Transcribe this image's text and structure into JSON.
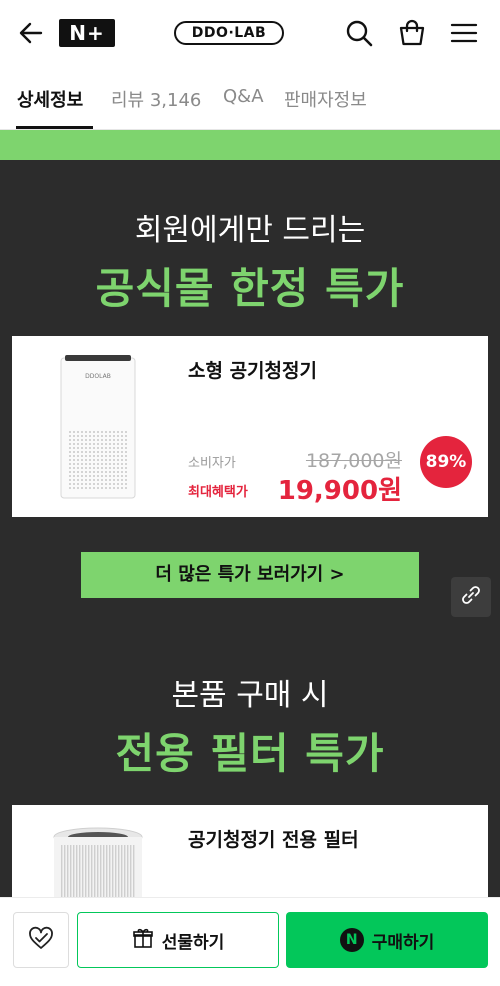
{
  "header": {
    "badge": "N+",
    "brand": "DDO·LAB"
  },
  "tabs": [
    {
      "label": "상세정보"
    },
    {
      "label": "리뷰 3,146"
    },
    {
      "label": "Q&A"
    },
    {
      "label": "판매자정보"
    }
  ],
  "promo1": {
    "line1": "회원에게만 드리는",
    "line2": "공식몰 한정 특가",
    "product": {
      "name": "소형 공기청정기",
      "image_label": "DDOLAB",
      "consumer_price_label": "소비자가",
      "max_benefit_label": "최대혜택가",
      "original_price": "187,000원",
      "sale_price": "19,900원",
      "discount": "89%"
    },
    "cta": "더 많은 특가 보러가기 >"
  },
  "promo2": {
    "line1": "본품 구매 시",
    "line2": "전용 필터 특가",
    "product": {
      "name": "공기청정기 전용 필터"
    }
  },
  "bottom": {
    "gift_label": "선물하기",
    "buy_label": "구매하기",
    "buy_icon_letter": "N"
  },
  "colors": {
    "accent_green": "#7ed46e",
    "naver_green": "#03c75a",
    "sale_red": "#e4243d",
    "dark_bg": "#2c2c2c"
  }
}
